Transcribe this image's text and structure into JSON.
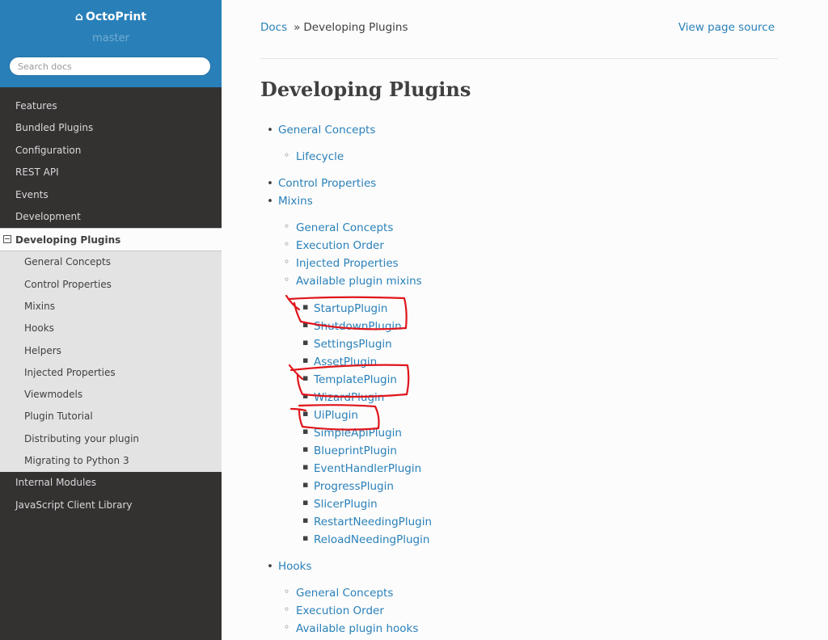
{
  "sidebar": {
    "project": "OctoPrint",
    "version": "master",
    "search_placeholder": "Search docs",
    "top_items": [
      "Features",
      "Bundled Plugins",
      "Configuration",
      "REST API",
      "Events",
      "Development"
    ],
    "current": "Developing Plugins",
    "sub_items": [
      "General Concepts",
      "Control Properties",
      "Mixins",
      "Hooks",
      "Helpers",
      "Injected Properties",
      "Viewmodels",
      "Plugin Tutorial",
      "Distributing your plugin",
      "Migrating to Python 3"
    ],
    "bottom_items": [
      "Internal Modules",
      "JavaScript Client Library"
    ]
  },
  "breadcrumb": {
    "home": "Docs",
    "separator": "»",
    "current": "Developing Plugins"
  },
  "view_source": "View page source",
  "page_title": "Developing Plugins",
  "toc": {
    "general_concepts": "General Concepts",
    "lifecycle": "Lifecycle",
    "control_properties": "Control Properties",
    "mixins": "Mixins",
    "mixins_children": [
      "General Concepts",
      "Execution Order",
      "Injected Properties",
      "Available plugin mixins"
    ],
    "plugin_mixins": [
      "StartupPlugin",
      "ShutdownPlugin",
      "SettingsPlugin",
      "AssetPlugin",
      "TemplatePlugin",
      "WizardPlugin",
      "UiPlugin",
      "SimpleApiPlugin",
      "BlueprintPlugin",
      "EventHandlerPlugin",
      "ProgressPlugin",
      "SlicerPlugin",
      "RestartNeedingPlugin",
      "ReloadNeedingPlugin"
    ],
    "hooks": "Hooks",
    "hooks_children": [
      "General Concepts",
      "Execution Order",
      "Available plugin hooks"
    ]
  },
  "colors": {
    "link": "#2980b9",
    "sidebar_bg": "#343131",
    "header_bg": "#2980b9",
    "annotation": "#e0151b"
  },
  "annotations": {
    "circled_items": [
      "StartupPlugin",
      "TemplatePlugin",
      "UiPlugin"
    ]
  }
}
